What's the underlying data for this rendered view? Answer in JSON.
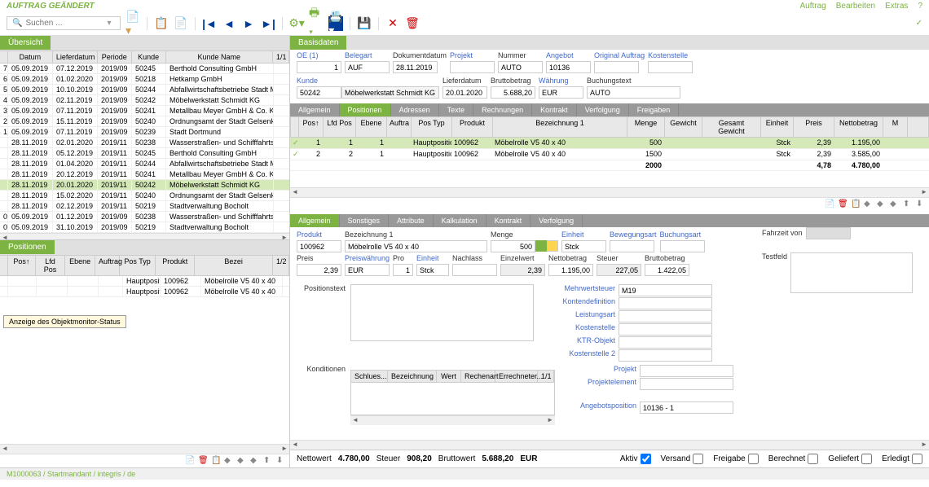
{
  "title": "AUFTRAG GEÄNDERT",
  "top_menu": {
    "auftrag": "Auftrag",
    "bearbeiten": "Bearbeiten",
    "extras": "Extras",
    "help": "?"
  },
  "search": {
    "placeholder": "Suchen ..."
  },
  "left": {
    "tab": "Übersicht",
    "headers": {
      "datum": "Datum",
      "liefer": "Lieferdatum",
      "periode": "Periode",
      "kunde": "Kunde",
      "kname": "Kunde Name",
      "rest": "1/1"
    },
    "rows": [
      {
        "n": "7",
        "d": "05.09.2019",
        "l": "07.12.2019",
        "p": "2019/09",
        "k": "50245",
        "name": "Berthold Consulting GmbH"
      },
      {
        "n": "6",
        "d": "05.09.2019",
        "l": "01.02.2020",
        "p": "2019/09",
        "k": "50218",
        "name": "Hetkamp GmbH"
      },
      {
        "n": "5",
        "d": "05.09.2019",
        "l": "10.10.2019",
        "p": "2019/09",
        "k": "50244",
        "name": "Abfallwirtschaftsbetriebe Stadt Mü..."
      },
      {
        "n": "4",
        "d": "05.09.2019",
        "l": "02.11.2019",
        "p": "2019/09",
        "k": "50242",
        "name": "Möbelwerkstatt Schmidt KG"
      },
      {
        "n": "3",
        "d": "05.09.2019",
        "l": "07.11.2019",
        "p": "2019/09",
        "k": "50241",
        "name": "Metallbau Meyer GmbH & Co. KG"
      },
      {
        "n": "2",
        "d": "05.09.2019",
        "l": "15.11.2019",
        "p": "2019/09",
        "k": "50240",
        "name": "Ordnungsamt der Stadt Gelsenkir..."
      },
      {
        "n": "1",
        "d": "05.09.2019",
        "l": "07.11.2019",
        "p": "2019/09",
        "k": "50239",
        "name": "Stadt Dortmund"
      },
      {
        "n": "",
        "d": "28.11.2019",
        "l": "02.01.2020",
        "p": "2019/11",
        "k": "50238",
        "name": "Wasserstraßen- und Schifffahrtsv..."
      },
      {
        "n": "",
        "d": "28.11.2019",
        "l": "05.12.2019",
        "p": "2019/11",
        "k": "50245",
        "name": "Berthold Consulting GmbH"
      },
      {
        "n": "",
        "d": "28.11.2019",
        "l": "01.04.2020",
        "p": "2019/11",
        "k": "50244",
        "name": "Abfallwirtschaftsbetriebe Stadt Mü..."
      },
      {
        "n": "",
        "d": "28.11.2019",
        "l": "20.12.2019",
        "p": "2019/11",
        "k": "50241",
        "name": "Metallbau Meyer GmbH & Co. KG"
      },
      {
        "n": "",
        "d": "28.11.2019",
        "l": "20.01.2020",
        "p": "2019/11",
        "k": "50242",
        "name": "Möbelwerkstatt Schmidt KG",
        "sel": true
      },
      {
        "n": "",
        "d": "28.11.2019",
        "l": "15.02.2020",
        "p": "2019/11",
        "k": "50240",
        "name": "Ordnungsamt der Stadt Gelsenkir..."
      },
      {
        "n": "",
        "d": "28.11.2019",
        "l": "02.12.2019",
        "p": "2019/11",
        "k": "50219",
        "name": "Stadtverwaltung Bocholt"
      },
      {
        "n": "0",
        "d": "05.09.2019",
        "l": "01.12.2019",
        "p": "2019/09",
        "k": "50238",
        "name": "Wasserstraßen- und Schifffahrtsv..."
      },
      {
        "n": "0",
        "d": "05.09.2019",
        "l": "31.10.2019",
        "p": "2019/09",
        "k": "50219",
        "name": "Stadtverwaltung Bocholt"
      }
    ],
    "tooltip": "Anzeige des Objektmonitor-Status",
    "pos_tab": "Positionen",
    "pos_headers": {
      "pos": "Pos↑",
      "lfd": "Lfd Pos",
      "ebene": "Ebene",
      "auftrag": "Auftrag",
      "typ": "Pos Typ",
      "produkt": "Produkt",
      "bez": "Bezei",
      "rest": "1/2"
    },
    "pos_rows": [
      {
        "typ": "Hauptposition",
        "prod": "100962",
        "bez": "Möbelrolle V5 40 x 40"
      },
      {
        "typ": "Hauptposition",
        "prod": "100962",
        "bez": "Möbelrolle V5 40 x 40"
      }
    ]
  },
  "basis": {
    "tab": "Basisdaten",
    "labels": {
      "oe": "OE (1)",
      "belegart": "Belegart",
      "dokdatum": "Dokumentdatum",
      "projekt": "Projekt",
      "nummer": "Nummer",
      "angebot": "Angebot",
      "origauftrag": "Original Auftrag",
      "kostenstelle": "Kostenstelle",
      "kunde": "Kunde",
      "lieferdatum": "Lieferdatum",
      "brutto": "Bruttobetrag",
      "waehrung": "Währung",
      "buchungstext": "Buchungstext"
    },
    "values": {
      "oe": "1",
      "belegart": "AUF",
      "dokdatum": "28.11.2019",
      "nummer": "AUTO",
      "angebot": "10136",
      "kunde": "50242",
      "kundename": "Möbelwerkstatt Schmidt KG",
      "lieferdatum": "20.01.2020",
      "brutto": "5.688,20",
      "waehrung": "EUR",
      "buchungstext": "AUTO"
    }
  },
  "tabs": [
    "Allgemein",
    "Positionen",
    "Adressen",
    "Texte",
    "Rechnungen",
    "Kontrakt",
    "Verfolgung",
    "Freigaben"
  ],
  "active_tab": "Positionen",
  "pos_grid": {
    "headers": {
      "pos": "Pos↑",
      "lfd": "Lfd Pos",
      "ebene": "Ebene",
      "auf": "Auftra",
      "typ": "Pos Typ",
      "prod": "Produkt",
      "bez": "Bezeichnung 1",
      "menge": "Menge",
      "gew": "Gewicht",
      "ggew": "Gesamt Gewicht",
      "einh": "Einheit",
      "preis": "Preis",
      "netto": "Nettobetrag",
      "rest": "M"
    },
    "rows": [
      {
        "chk": "✓",
        "pos": "1",
        "lfd": "1",
        "ebene": "1",
        "typ": "Hauptposition",
        "prod": "100962",
        "bez": "Möbelrolle V5 40 x 40",
        "menge": "500",
        "einh": "Stck",
        "preis": "2,39",
        "netto": "1.195,00",
        "sel": true
      },
      {
        "chk": "✓",
        "pos": "2",
        "lfd": "2",
        "ebene": "1",
        "typ": "Hauptposition",
        "prod": "100962",
        "bez": "Möbelrolle V5 40 x 40",
        "menge": "1500",
        "einh": "Stck",
        "preis": "2,39",
        "netto": "3.585,00"
      }
    ],
    "totals": {
      "menge": "2000",
      "preis": "4,78",
      "netto": "4.780,00"
    }
  },
  "detail_tabs": [
    "Allgemein",
    "Sonstiges",
    "Attribute",
    "Kalkulation",
    "Kontrakt",
    "Verfolgung"
  ],
  "detail_active": "Allgemein",
  "detail": {
    "labels": {
      "produkt": "Produkt",
      "bez1": "Bezeichnung 1",
      "menge": "Menge",
      "einheit": "Einheit",
      "bewegungsart": "Bewegungsart",
      "buchungsart": "Buchungsart",
      "preis": "Preis",
      "preiswaehrung": "Preiswährung",
      "pro": "Pro",
      "einheit2": "Einheit",
      "nachlass": "Nachlass",
      "einzelwert": "Einzelwert",
      "nettobetrag": "Nettobetrag",
      "steuer": "Steuer",
      "bruttobetrag": "Bruttobetrag",
      "fahrzeit": "Fahrzeit von",
      "testfeld": "Testfeld",
      "positionstext": "Positionstext",
      "mwst": "Mehrwertsteuer",
      "kontendef": "Kontendefinition",
      "leistungsart": "Leistungsart",
      "kostenstelle": "Kostenstelle",
      "ktr": "KTR-Objekt",
      "kostenstelle2": "Kostenstelle 2",
      "konditionen": "Konditionen",
      "projekt": "Projekt",
      "projektelement": "Projektelement",
      "angebotspos": "Angebotsposition"
    },
    "values": {
      "produkt": "100962",
      "bez1": "Möbelrolle V5 40 x 40",
      "menge": "500",
      "einheit": "Stck",
      "preis": "2,39",
      "preiswaehrung": "EUR",
      "pro": "1",
      "einheit2": "Stck",
      "einzelwert": "2,39",
      "nettobetrag": "1.195,00",
      "steuer": "227,05",
      "bruttobetrag": "1.422,05",
      "mwst": "M19",
      "angebotspos": "10136 - 1"
    },
    "kond_headers": {
      "schlues": "Schlues...",
      "bez": "Bezeichnung",
      "wert": "Wert",
      "rechenart": "Rechenart",
      "errechnet": "Errechneter...",
      "rest": "1/1"
    }
  },
  "footer": {
    "nettowert": "Nettowert",
    "nettowert_v": "4.780,00",
    "steuer": "Steuer",
    "steuer_v": "908,20",
    "bruttowert": "Bruttowert",
    "bruttowert_v": "5.688,20",
    "eur": "EUR",
    "aktiv": "Aktiv",
    "versand": "Versand",
    "freigabe": "Freigabe",
    "berechnet": "Berechnet",
    "geliefert": "Geliefert",
    "erledigt": "Erledigt"
  },
  "status": "M1000063 / Startmandant / integris / de"
}
